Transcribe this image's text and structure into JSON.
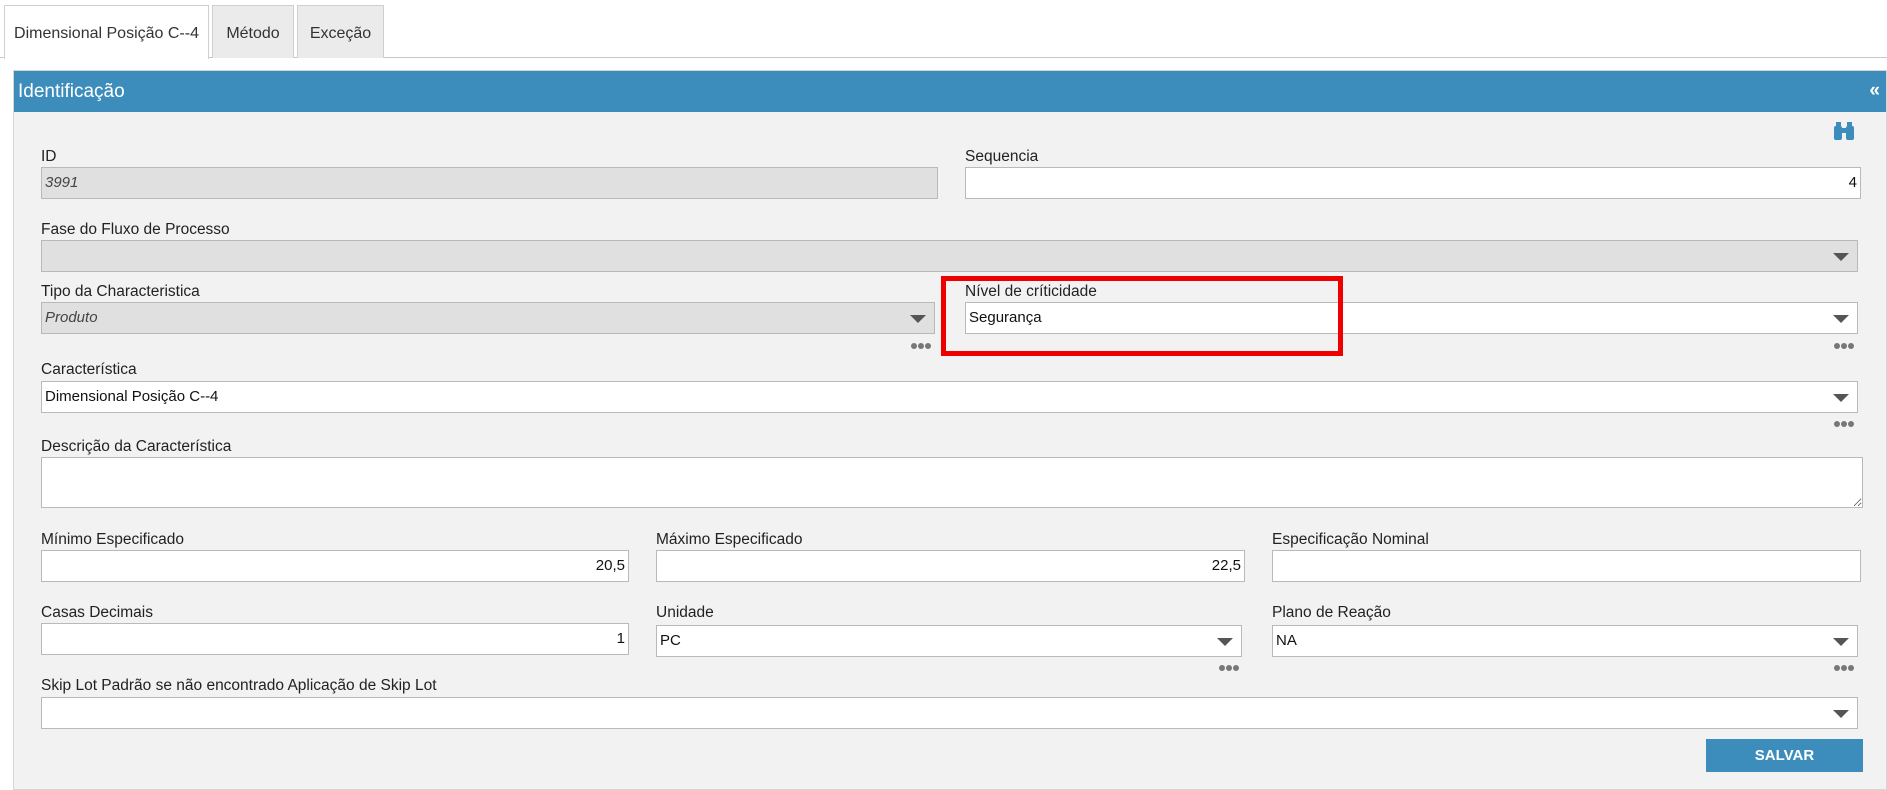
{
  "tabs": [
    {
      "label": "Dimensional Posição C--4"
    },
    {
      "label": "Método"
    },
    {
      "label": "Exceção"
    }
  ],
  "panel": {
    "title": "Identificação",
    "collapse": "«"
  },
  "fields": {
    "id": {
      "label": "ID",
      "value": "3991"
    },
    "sequencia": {
      "label": "Sequencia",
      "value": "4"
    },
    "fase": {
      "label": "Fase do Fluxo de Processo",
      "value": ""
    },
    "tipo": {
      "label": "Tipo da Characteristica",
      "value": "Produto"
    },
    "nivel": {
      "label": "Nível de críticidade",
      "value": "Segurança"
    },
    "caracteristica": {
      "label": "Característica",
      "value": "Dimensional Posição C--4"
    },
    "descricao": {
      "label": "Descrição da Característica",
      "value": ""
    },
    "minimo": {
      "label": "Mínimo Especificado",
      "value": "20,5"
    },
    "maximo": {
      "label": "Máximo Especificado",
      "value": "22,5"
    },
    "nominal": {
      "label": "Especificação Nominal",
      "value": ""
    },
    "casas": {
      "label": "Casas Decimais",
      "value": "1"
    },
    "unidade": {
      "label": "Unidade",
      "value": "PC"
    },
    "plano": {
      "label": "Plano de Reação",
      "value": "NA"
    },
    "skiplot": {
      "label": "Skip Lot Padrão se não encontrado Aplicação de Skip Lot",
      "value": ""
    }
  },
  "actions": {
    "save_label": "SALVAR"
  },
  "colors": {
    "accent": "#3c8dbc",
    "highlight": "#ee0000"
  },
  "icons": {
    "search": "binoculars-icon",
    "more": "more-dots-icon",
    "dropdown": "chevron-down-icon"
  }
}
